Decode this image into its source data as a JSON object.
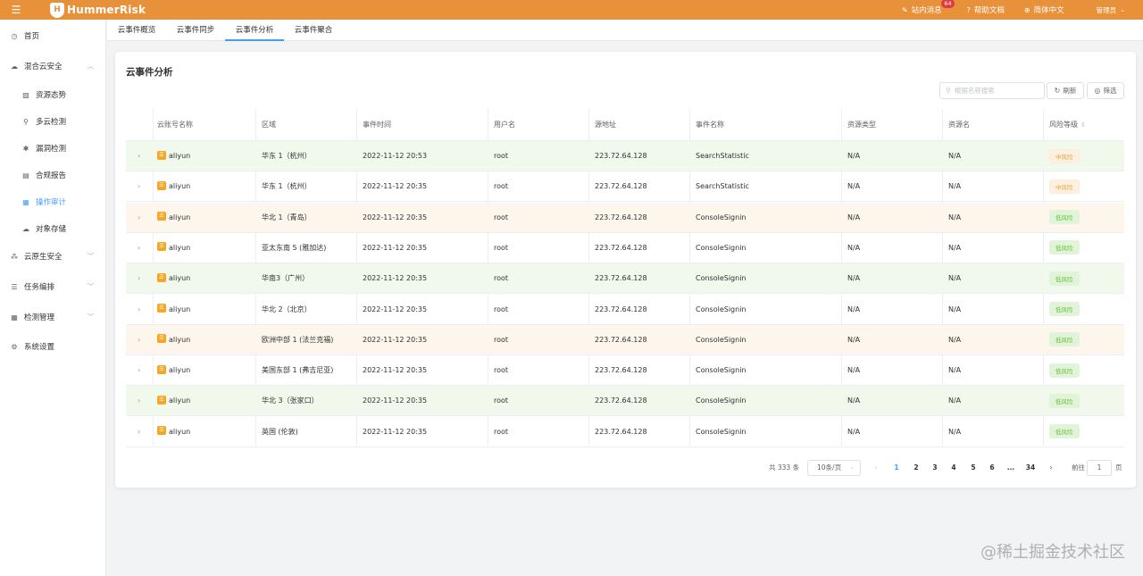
{
  "topbar": {
    "brand": "HummerRisk",
    "messages_label": "站内消息",
    "messages_badge": "64",
    "help_label": "帮助文档",
    "lang_label": "简体中文",
    "user_label": "管理员"
  },
  "sidebar": {
    "items": [
      {
        "label": "首页",
        "icon": "clock-icon"
      },
      {
        "label": "混合云安全",
        "icon": "cloud-icon"
      },
      {
        "label": "资源态势",
        "icon": "chart-icon"
      },
      {
        "label": "多云检测",
        "icon": "scan-icon"
      },
      {
        "label": "漏洞检测",
        "icon": "bug-icon"
      },
      {
        "label": "合规报告",
        "icon": "report-icon"
      },
      {
        "label": "操作审计",
        "icon": "audit-icon"
      },
      {
        "label": "对象存储",
        "icon": "storage-icon"
      },
      {
        "label": "云原生安全",
        "icon": "cluster-icon"
      },
      {
        "label": "任务编排",
        "icon": "list-icon"
      },
      {
        "label": "检测管理",
        "icon": "grid-icon"
      },
      {
        "label": "系统设置",
        "icon": "gear-icon"
      }
    ]
  },
  "tabs": [
    "云事件概览",
    "云事件同步",
    "云事件分析",
    "云事件聚合"
  ],
  "card": {
    "title": "云事件分析",
    "search_placeholder": "根据名称搜索",
    "refresh_label": "刷新",
    "filter_label": "筛选"
  },
  "table": {
    "headers": [
      "云账号名称",
      "区域",
      "事件时间",
      "用户名",
      "源地址",
      "事件名称",
      "资源类型",
      "资源名",
      "风险等级"
    ],
    "rows": [
      {
        "account": "aliyun",
        "region": "华东 1（杭州）",
        "time": "2022-11-12 20:53",
        "user": "root",
        "ip": "223.72.64.128",
        "event": "SearchStatistic",
        "rtype": "N/A",
        "rname": "N/A",
        "risk": "中风险"
      },
      {
        "account": "aliyun",
        "region": "华东 1（杭州）",
        "time": "2022-11-12 20:35",
        "user": "root",
        "ip": "223.72.64.128",
        "event": "SearchStatistic",
        "rtype": "N/A",
        "rname": "N/A",
        "risk": "中风险"
      },
      {
        "account": "aliyun",
        "region": "华北 1（青岛）",
        "time": "2022-11-12 20:35",
        "user": "root",
        "ip": "223.72.64.128",
        "event": "ConsoleSignin",
        "rtype": "N/A",
        "rname": "N/A",
        "risk": "低风险"
      },
      {
        "account": "aliyun",
        "region": "亚太东南 5 (雅加达)",
        "time": "2022-11-12 20:35",
        "user": "root",
        "ip": "223.72.64.128",
        "event": "ConsoleSignin",
        "rtype": "N/A",
        "rname": "N/A",
        "risk": "低风险"
      },
      {
        "account": "aliyun",
        "region": "华南3（广州）",
        "time": "2022-11-12 20:35",
        "user": "root",
        "ip": "223.72.64.128",
        "event": "ConsoleSignin",
        "rtype": "N/A",
        "rname": "N/A",
        "risk": "低风险"
      },
      {
        "account": "aliyun",
        "region": "华北 2（北京）",
        "time": "2022-11-12 20:35",
        "user": "root",
        "ip": "223.72.64.128",
        "event": "ConsoleSignin",
        "rtype": "N/A",
        "rname": "N/A",
        "risk": "低风险"
      },
      {
        "account": "aliyun",
        "region": "欧洲中部 1 (法兰克福)",
        "time": "2022-11-12 20:35",
        "user": "root",
        "ip": "223.72.64.128",
        "event": "ConsoleSignin",
        "rtype": "N/A",
        "rname": "N/A",
        "risk": "低风险"
      },
      {
        "account": "aliyun",
        "region": "美国东部 1 (弗吉尼亚)",
        "time": "2022-11-12 20:35",
        "user": "root",
        "ip": "223.72.64.128",
        "event": "ConsoleSignin",
        "rtype": "N/A",
        "rname": "N/A",
        "risk": "低风险"
      },
      {
        "account": "aliyun",
        "region": "华北 3（张家口）",
        "time": "2022-11-12 20:35",
        "user": "root",
        "ip": "223.72.64.128",
        "event": "ConsoleSignin",
        "rtype": "N/A",
        "rname": "N/A",
        "risk": "低风险"
      },
      {
        "account": "aliyun",
        "region": "英国 (伦敦)",
        "time": "2022-11-12 20:35",
        "user": "root",
        "ip": "223.72.64.128",
        "event": "ConsoleSignin",
        "rtype": "N/A",
        "rname": "N/A",
        "risk": "低风险"
      }
    ]
  },
  "pagination": {
    "total": "共 333 条",
    "page_size": "10条/页",
    "pages": [
      "1",
      "2",
      "3",
      "4",
      "5",
      "6",
      "...",
      "34"
    ],
    "current": "1",
    "goto_prefix": "前往",
    "goto_value": "1",
    "goto_suffix": "页"
  },
  "watermark": "@稀土掘金技术社区",
  "colors": {
    "accent": "#e8913b",
    "primary": "#409eff",
    "row_green": "#f0f9eb",
    "row_orange": "#fdf6ec"
  }
}
